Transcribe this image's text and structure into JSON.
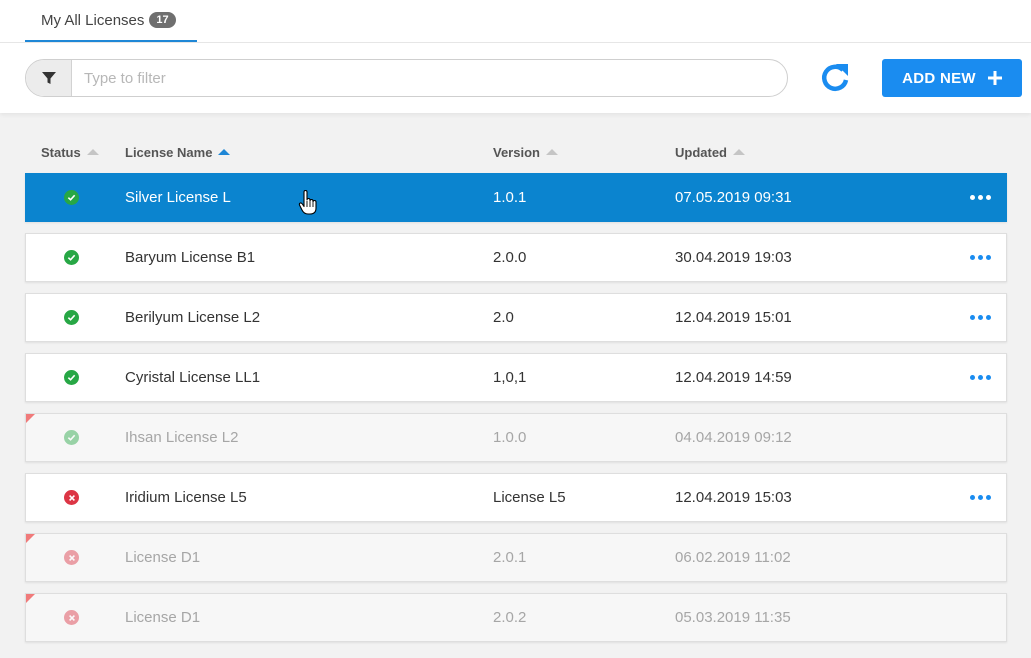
{
  "tab": {
    "label": "My All Licenses",
    "count": "17"
  },
  "filter": {
    "placeholder": "Type to filter"
  },
  "add_button": {
    "label": "ADD NEW"
  },
  "columns": {
    "status": "Status",
    "name": "License Name",
    "version": "Version",
    "updated": "Updated"
  },
  "colors": {
    "accent": "#1a8cf0",
    "selected": "#0b84cf",
    "ok": "#27a745",
    "error": "#dc3545"
  },
  "rows": [
    {
      "status": "ok",
      "name": "Silver License L",
      "version": "1.0.1",
      "updated": "07.05.2019 09:31",
      "selected": true
    },
    {
      "status": "ok",
      "name": "Baryum License B1",
      "version": "2.0.0",
      "updated": "30.04.2019 19:03"
    },
    {
      "status": "ok",
      "name": "Berilyum License L2",
      "version": "2.0",
      "updated": "12.04.2019 15:01"
    },
    {
      "status": "ok",
      "name": "Cyristal License LL1",
      "version": "1,0,1",
      "updated": "12.04.2019 14:59"
    },
    {
      "status": "ok",
      "name": "Ihsan License L2",
      "version": "1.0.0",
      "updated": "04.04.2019 09:12",
      "disabled": true
    },
    {
      "status": "error",
      "name": "Iridium License L5",
      "version": "License L5",
      "updated": "12.04.2019 15:03"
    },
    {
      "status": "error",
      "name": "License D1",
      "version": "2.0.1",
      "updated": "06.02.2019 11:02",
      "disabled": true
    },
    {
      "status": "error",
      "name": "License D1",
      "version": "2.0.2",
      "updated": "05.03.2019 11:35",
      "disabled": true
    }
  ]
}
